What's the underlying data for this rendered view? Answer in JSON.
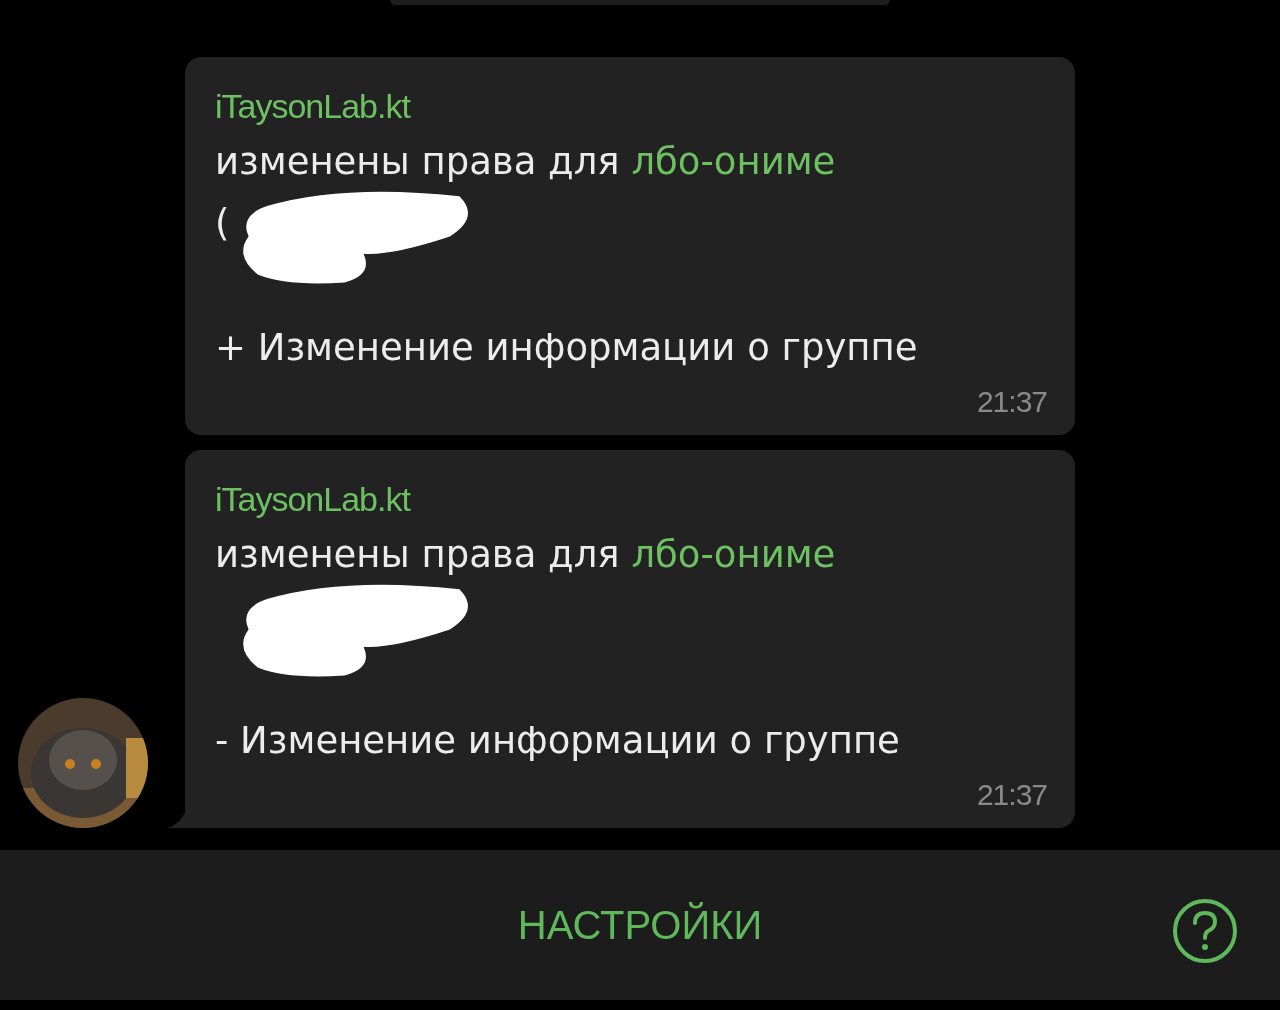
{
  "messages": [
    {
      "sender": "iTaysonLab.kt",
      "text": "изменены права для",
      "mention": "лбо-ониме",
      "paren": "(",
      "change": "+ Изменение информации о группе",
      "time": "21:37",
      "redacted": true,
      "tail": false
    },
    {
      "sender": "iTaysonLab.kt",
      "text": "изменены права для",
      "mention": "лбо-ониме",
      "change": "- Изменение информации о группе",
      "time": "21:37",
      "redacted": true,
      "tail": true
    }
  ],
  "bottom_bar": {
    "button": "НАСТРОЙКИ"
  }
}
